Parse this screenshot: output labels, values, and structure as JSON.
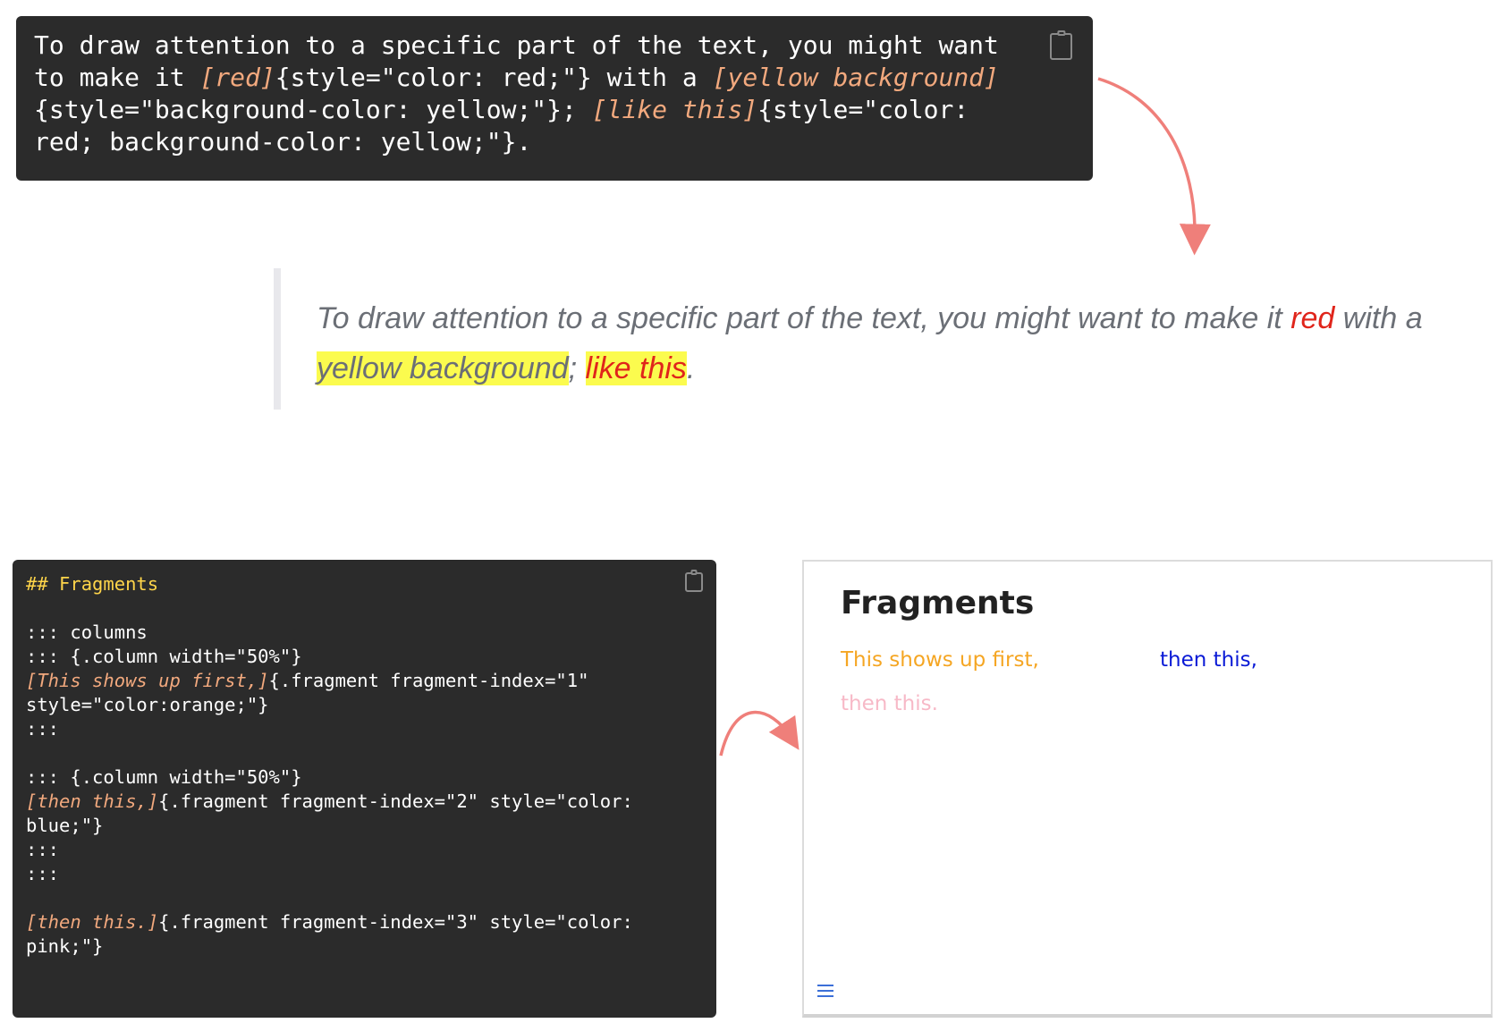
{
  "code_block_1": {
    "lines": [
      [
        {
          "t": "To draw attention to a specific part of the text, you might want",
          "c": ""
        }
      ],
      [
        {
          "t": "to make it ",
          "c": ""
        },
        {
          "t": "[red]",
          "c": "hl"
        },
        {
          "t": "{style=\"color: red;\"} with a ",
          "c": ""
        },
        {
          "t": "[yellow background]",
          "c": "hl"
        }
      ],
      [
        {
          "t": "{style=\"background-color: yellow;\"}; ",
          "c": ""
        },
        {
          "t": "[like this]",
          "c": "hl"
        },
        {
          "t": "{style=\"color:",
          "c": ""
        }
      ],
      [
        {
          "t": "red; background-color: yellow;\"}.",
          "c": ""
        }
      ]
    ],
    "copy_icon": "clipboard-icon"
  },
  "rendered_quote": {
    "part1": "To draw attention to a specific part of the text, you might want to make it ",
    "red": "red",
    "part2": " with a ",
    "yellow": "yellow background",
    "part3": "; ",
    "both": "like this",
    "part4": "."
  },
  "code_block_2": {
    "lines": [
      [
        {
          "t": "## Fragments",
          "c": "hd"
        }
      ],
      [
        {
          "t": "",
          "c": ""
        }
      ],
      [
        {
          "t": "::: columns",
          "c": ""
        }
      ],
      [
        {
          "t": "::: {.column width=\"50%\"}",
          "c": ""
        }
      ],
      [
        {
          "t": "[This shows up first,]",
          "c": "hl"
        },
        {
          "t": "{.fragment fragment-index=\"1\"",
          "c": ""
        }
      ],
      [
        {
          "t": "style=\"color:orange;\"}",
          "c": ""
        }
      ],
      [
        {
          "t": ":::",
          "c": ""
        }
      ],
      [
        {
          "t": "",
          "c": ""
        }
      ],
      [
        {
          "t": "::: {.column width=\"50%\"}",
          "c": ""
        }
      ],
      [
        {
          "t": "[then this,]",
          "c": "hl"
        },
        {
          "t": "{.fragment fragment-index=\"2\" style=\"color:",
          "c": ""
        }
      ],
      [
        {
          "t": "blue;\"}",
          "c": ""
        }
      ],
      [
        {
          "t": ":::",
          "c": ""
        }
      ],
      [
        {
          "t": ":::",
          "c": ""
        }
      ],
      [
        {
          "t": "",
          "c": ""
        }
      ],
      [
        {
          "t": "[then this.]",
          "c": "hl"
        },
        {
          "t": "{.fragment fragment-index=\"3\" style=\"color:",
          "c": ""
        }
      ],
      [
        {
          "t": "pink;\"}",
          "c": ""
        }
      ]
    ],
    "copy_icon": "clipboard-icon"
  },
  "slide_preview": {
    "title": "Fragments",
    "fragment_1": "This shows up first,",
    "fragment_2": "then this,",
    "fragment_3": "then this.",
    "menu_icon": "hamburger-menu-icon"
  },
  "colors": {
    "code_bg": "#2b2b2b",
    "highlight": "#f2a97e",
    "heading": "#ffd54a",
    "arrow": "#ef7f7a",
    "orange": "#f5a623",
    "blue": "#0a1ad6",
    "pink": "#f7b9c7"
  }
}
